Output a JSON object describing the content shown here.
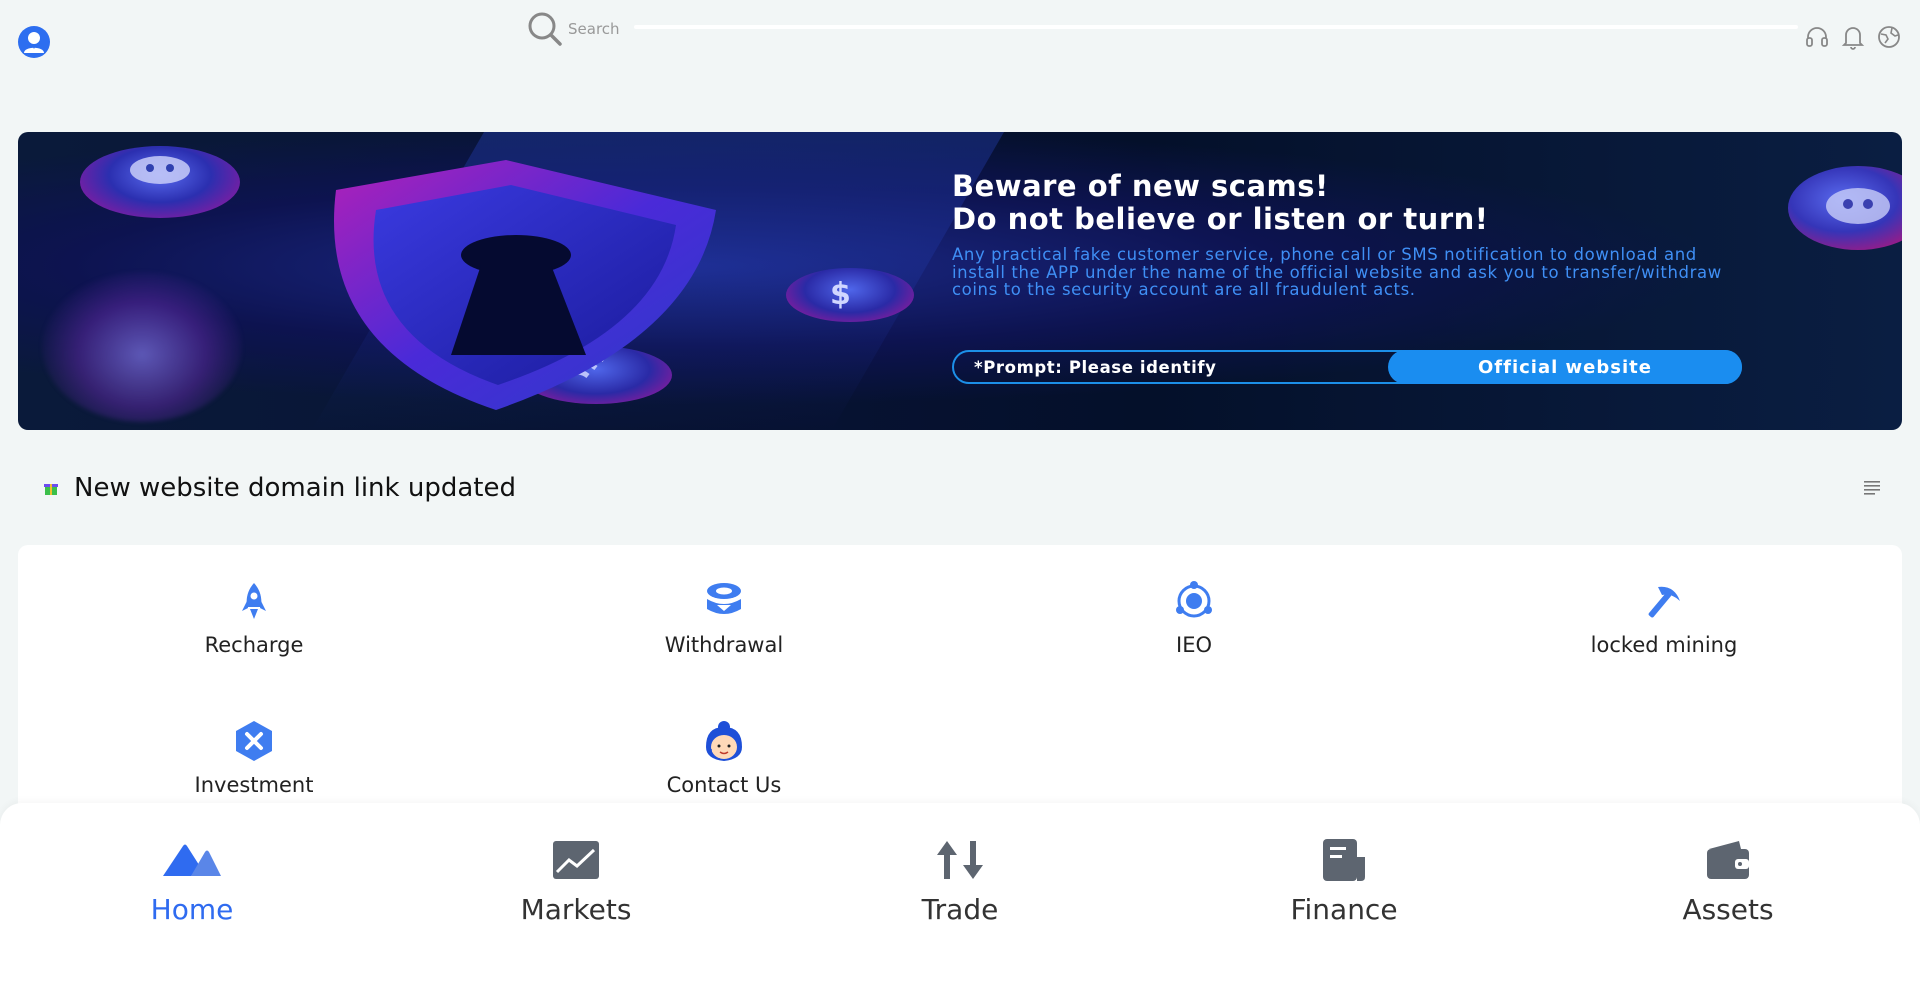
{
  "header": {
    "avatar_icon": "user-avatar-icon",
    "search": {
      "placeholder": "Search",
      "icon": "search-icon"
    },
    "icons": [
      "headset-icon",
      "bell-icon",
      "globe-icon"
    ]
  },
  "banner": {
    "title_line1": "Beware of new scams!",
    "title_line2": "Do not believe or listen or turn!",
    "body": "Any practical fake customer service, phone call or SMS notification to download and install the APP under the name of the official website and ask you to transfer/withdraw coins to the security account are all fraudulent acts.",
    "prompt": "*Prompt: Please identify",
    "official_button": "Official website",
    "colors": {
      "accent": "#1a8df0",
      "body_text": "#3f8ff5",
      "background": "#071233"
    }
  },
  "notice": {
    "icon": "gift-icon",
    "text": "New website domain link updated",
    "menu_icon": "list-icon"
  },
  "quick_actions": [
    {
      "label": "Recharge",
      "icon": "rocket-icon"
    },
    {
      "label": "Withdrawal",
      "icon": "coin-stack-icon"
    },
    {
      "label": "IEO",
      "icon": "orbit-icon"
    },
    {
      "label": "locked mining",
      "icon": "pickaxe-icon"
    },
    {
      "label": "Investment",
      "icon": "hexagon-x-icon"
    },
    {
      "label": "Contact Us",
      "icon": "support-agent-icon"
    }
  ],
  "tabbar": {
    "active": "Home",
    "active_color": "#2f6bf0",
    "tabs": [
      {
        "label": "Home",
        "icon": "home-mountains-icon"
      },
      {
        "label": "Markets",
        "icon": "chart-icon"
      },
      {
        "label": "Trade",
        "icon": "up-down-arrows-icon"
      },
      {
        "label": "Finance",
        "icon": "document-icon"
      },
      {
        "label": "Assets",
        "icon": "wallet-icon"
      }
    ]
  }
}
